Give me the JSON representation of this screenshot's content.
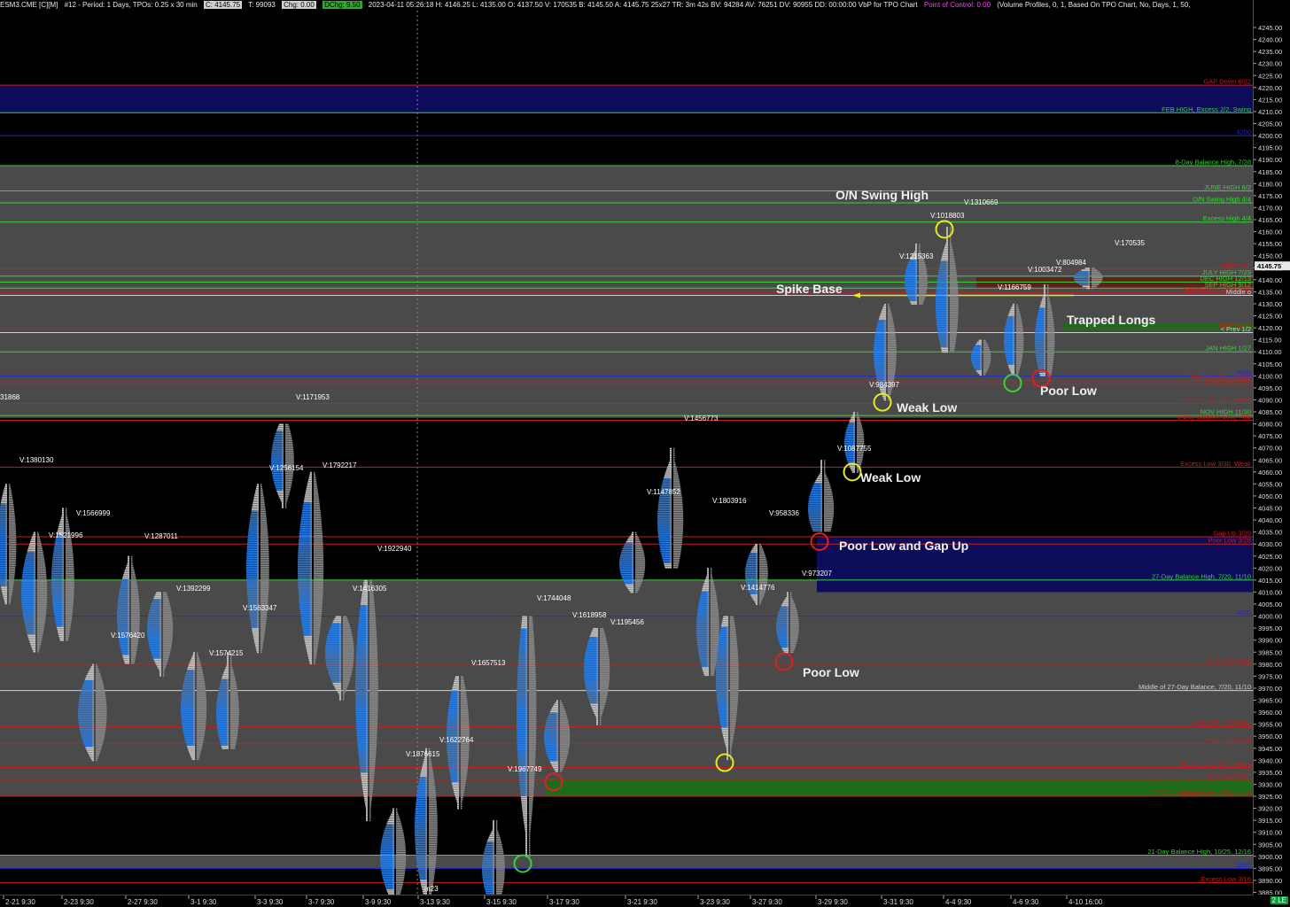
{
  "title_bar": {
    "symbol": "ESM3.CME [C][M]",
    "period": "#12 - Period: 1 Days, TPOs: 0.25 x 30 min",
    "last_price": "C: 4145.75",
    "ticks": "T: 99093",
    "chg": "Chg: 0.00",
    "dchg": "DChg: 9.50",
    "stats": "2023-04-11 05:26:18 H: 4146.25 L: 4135.00 O: 4137.50 V: 170535 B: 4145.50 A: 4145.75 25x27 TR: 3m 42s BV: 94284 AV: 76251 DV: 90955 DD: 00:00:00 VbP for TPO Chart",
    "poc": "Point of Control: 0.00",
    "study": "(Volume Profiles, 0, 1, Based On TPO Chart, No, Days, 1, 50,"
  },
  "price_axis": {
    "min": 3882.5,
    "max": 4250,
    "labels": [
      "4245.00",
      "4240.00",
      "4235.00",
      "4230.00",
      "4225.00",
      "4220.00",
      "4215.00",
      "4210.00",
      "4205.00",
      "4200.00",
      "4195.00",
      "4190.00",
      "4185.00",
      "4180.00",
      "4175.00",
      "4170.00",
      "4165.00",
      "4160.00",
      "4155.00",
      "4150.00",
      "4145.00",
      "4140.00",
      "4135.00",
      "4130.00",
      "4125.00",
      "4120.00",
      "4115.00",
      "4110.00",
      "4105.00",
      "4100.00",
      "4095.00",
      "4090.00",
      "4085.00",
      "4080.00",
      "4075.00",
      "4070.00",
      "4065.00",
      "4060.00",
      "4055.00",
      "4050.00",
      "4045.00",
      "4040.00",
      "4035.00",
      "4030.00",
      "4025.00",
      "4020.00",
      "4015.00",
      "4010.00",
      "4005.00",
      "4000.00",
      "3995.00",
      "3990.00",
      "3985.00",
      "3980.00",
      "3975.00",
      "3970.00",
      "3965.00",
      "3960.00",
      "3955.00",
      "3950.00",
      "3945.00",
      "3940.00",
      "3935.00",
      "3930.00",
      "3925.00",
      "3920.00",
      "3915.00",
      "3910.00",
      "3905.00",
      "3900.00",
      "3895.00",
      "3890.00",
      "3885.00"
    ],
    "current_price_label": "4145.75"
  },
  "date_axis": {
    "labels": [
      "2-21 9:30",
      "2-23 9:30",
      "2-27 9:30",
      "3-1 9:30",
      "3-3 9:30",
      "3-7 9:30",
      "3-9 9:30",
      "3-13 9:30",
      "3-15 9:30",
      "3-17 9:30",
      "3-21 9:30",
      "3-23 9:30",
      "3-27 9:30",
      "3-29 9:30",
      "3-31 9:30",
      "4-4 9:30",
      "4-6 9:30",
      "4-10 16:00"
    ]
  },
  "colors": {
    "gray_band": "#4a4a4a",
    "gap_blue": "#0c0c5a",
    "green_zone": "#1e6b1e",
    "green_line": "#3ad23a",
    "red_line": "#c81e1e",
    "blue_line": "#2828c8",
    "white_line": "#cfcfcf",
    "yellow": "#e8e81e",
    "profile_blue": "#2c7ce0",
    "profile_gray": "#8a8a8a"
  },
  "levels": [
    {
      "label": "GAP Down 8/22",
      "color": "red"
    },
    {
      "label": "FEB HIGH, Excess 2/2, Swing",
      "color": "green"
    },
    {
      "label": "4200",
      "color": "blue"
    },
    {
      "label": "8-Day Balance High, 7/28",
      "color": "green"
    },
    {
      "label": "JUNE HIGH 6/2",
      "color": "green"
    },
    {
      "label": "O/N Swing High 4/4",
      "color": "green"
    },
    {
      "label": "Excess High 4/4",
      "color": "green"
    },
    {
      "label": "Singles 4/3",
      "color": "red"
    },
    {
      "label": "JULY HIGH 7/29",
      "color": "green"
    },
    {
      "label": "DEC HIGH 12/13",
      "color": "green"
    },
    {
      "label": "SEP HIGH 9/12",
      "color": "green"
    },
    {
      "label": "Spike Base (Low) 4/10",
      "color": "red"
    },
    {
      "label": "Middle o",
      "color": "white"
    },
    {
      "label": "Singles 4/10",
      "color": "red"
    },
    {
      "label": "< Prev 1/2",
      "color": "white"
    },
    {
      "label": "JAN HIGH 1/27",
      "color": "green"
    },
    {
      "label": "4100",
      "color": "blue"
    },
    {
      "label": "Poor Low 4/10, Weak",
      "color": "red"
    },
    {
      "label": "Excess Low 4/6",
      "color": "red"
    },
    {
      "label": "Excess Low 3/31, Weak",
      "color": "red"
    },
    {
      "label": "NOV HIGH 11/30",
      "color": "green"
    },
    {
      "label": "8-Day Balance Low, 7/28",
      "color": "red"
    },
    {
      "label": "Excess Low 3/30, Weak",
      "color": "red"
    },
    {
      "label": "Gap Up 3/29",
      "color": "red"
    },
    {
      "label": "Poor Low 3/28",
      "color": "red"
    },
    {
      "label": "27-Day Balance High, 7/20, 11/10",
      "color": "green"
    },
    {
      "label": "4000",
      "color": "blue"
    },
    {
      "label": "Poor Low 3/28",
      "color": "red"
    },
    {
      "label": "Middle of 27-Day Balance, 7/20, 11/10",
      "color": "white"
    },
    {
      "label": "AUGUST LOW 8/31",
      "color": "red"
    },
    {
      "label": "FEB LOW 2/24",
      "color": "red"
    },
    {
      "label": "Excess Low 3/24, Weak",
      "color": "red"
    },
    {
      "label": "Poor Low 3/17",
      "color": "red"
    },
    {
      "label": "27-Day Balance Low, 7/20, 11/10",
      "color": "red"
    },
    {
      "label": "21-Day Balance High, 10/25, 12/16",
      "color": "green"
    },
    {
      "label": "3900",
      "color": "blue"
    },
    {
      "label": "Excess Low 3/16",
      "color": "red"
    }
  ],
  "annotations": [
    "O/N Swing High",
    "Spike Base",
    "Trapped Longs",
    "Poor Low",
    "Weak Low",
    "Weak Low",
    "Poor Low and Gap Up",
    "Poor Low"
  ],
  "volume_labels": [
    "31868",
    "V:1380130",
    "V:1566999",
    "V:1521996",
    "V:1287011",
    "V:1392299",
    "V:1576420",
    "V:1574215",
    "V:1563347",
    "V:1171953",
    "V:1256154",
    "V:1792217",
    "V:1922940",
    "V:1416305",
    "V:1744048",
    "V:1618958",
    "V:1195456",
    "V:1657513",
    "V:1622764",
    "V:1876615",
    "V:1967749",
    "m23",
    "V:1456773",
    "V:1147852",
    "V:1803916",
    "V:958336",
    "V:1414776",
    "V:973207",
    "V:1087755",
    "V:984397",
    "V:1215363",
    "V:1018803",
    "V:1310669",
    "V:1166759",
    "V:1003472",
    "V:804984",
    "V:170535"
  ]
}
